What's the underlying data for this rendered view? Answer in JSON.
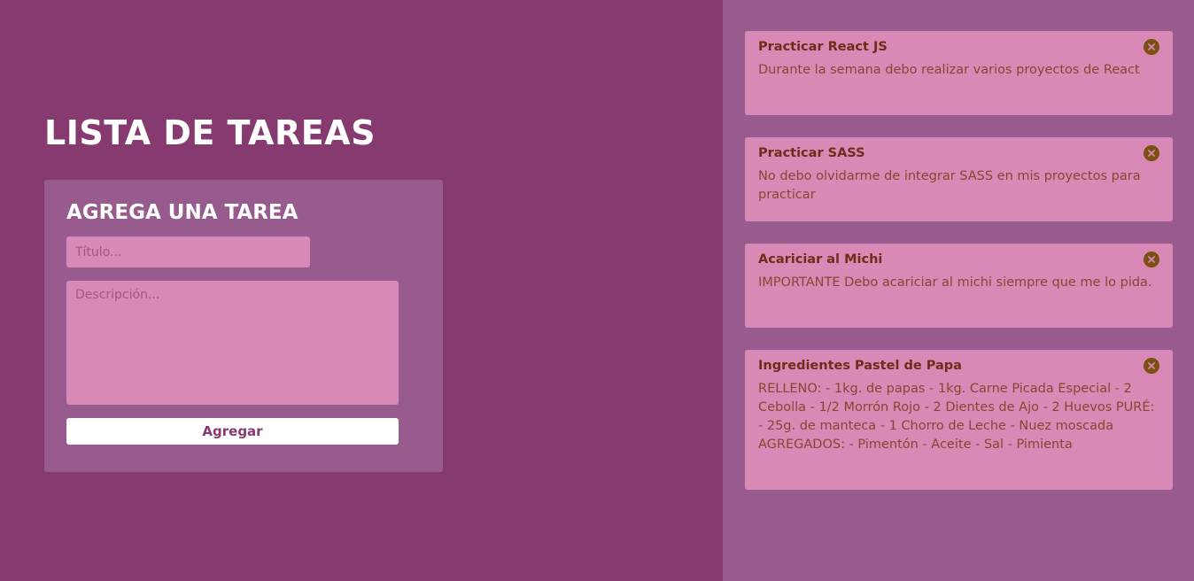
{
  "app": {
    "title": "LISTA DE TAREAS"
  },
  "form": {
    "title": "AGREGA UNA TAREA",
    "title_placeholder": "Título...",
    "title_value": "",
    "description_placeholder": "Descripción...",
    "description_value": "",
    "submit_label": "Agregar"
  },
  "tasks": [
    {
      "title": "Practicar React JS",
      "description": "Durante la semana debo realizar varios proyectos de React",
      "icon": "close-icon"
    },
    {
      "title": "Practicar SASS",
      "description": "No debo olvidarme de integrar SASS en mis proyectos para practicar",
      "icon": "close-icon"
    },
    {
      "title": "Acariciar al Michi",
      "description": "IMPORTANTE Debo acariciar al michi siempre que me lo pida.",
      "icon": "close-icon"
    },
    {
      "title": "Ingredientes Pastel de Papa",
      "description": "RELLENO: - 1kg. de papas - 1kg. Carne Picada Especial - 2 Cebolla - 1/2 Morrón Rojo - 2 Dientes de Ajo - 2 Huevos PURÉ: - 25g. de manteca - 1 Chorro de Leche - Nuez moscada AGREGADOS: - Pimentón - Aceite - Sal - Pimienta",
      "icon": "close-icon"
    }
  ],
  "colors": {
    "background": "#863a6f",
    "sidebar": "#975c8d",
    "card": "#d989b5",
    "accent_text": "#6e2d18",
    "close_icon": "#7a5010",
    "button": "#ffffff"
  }
}
